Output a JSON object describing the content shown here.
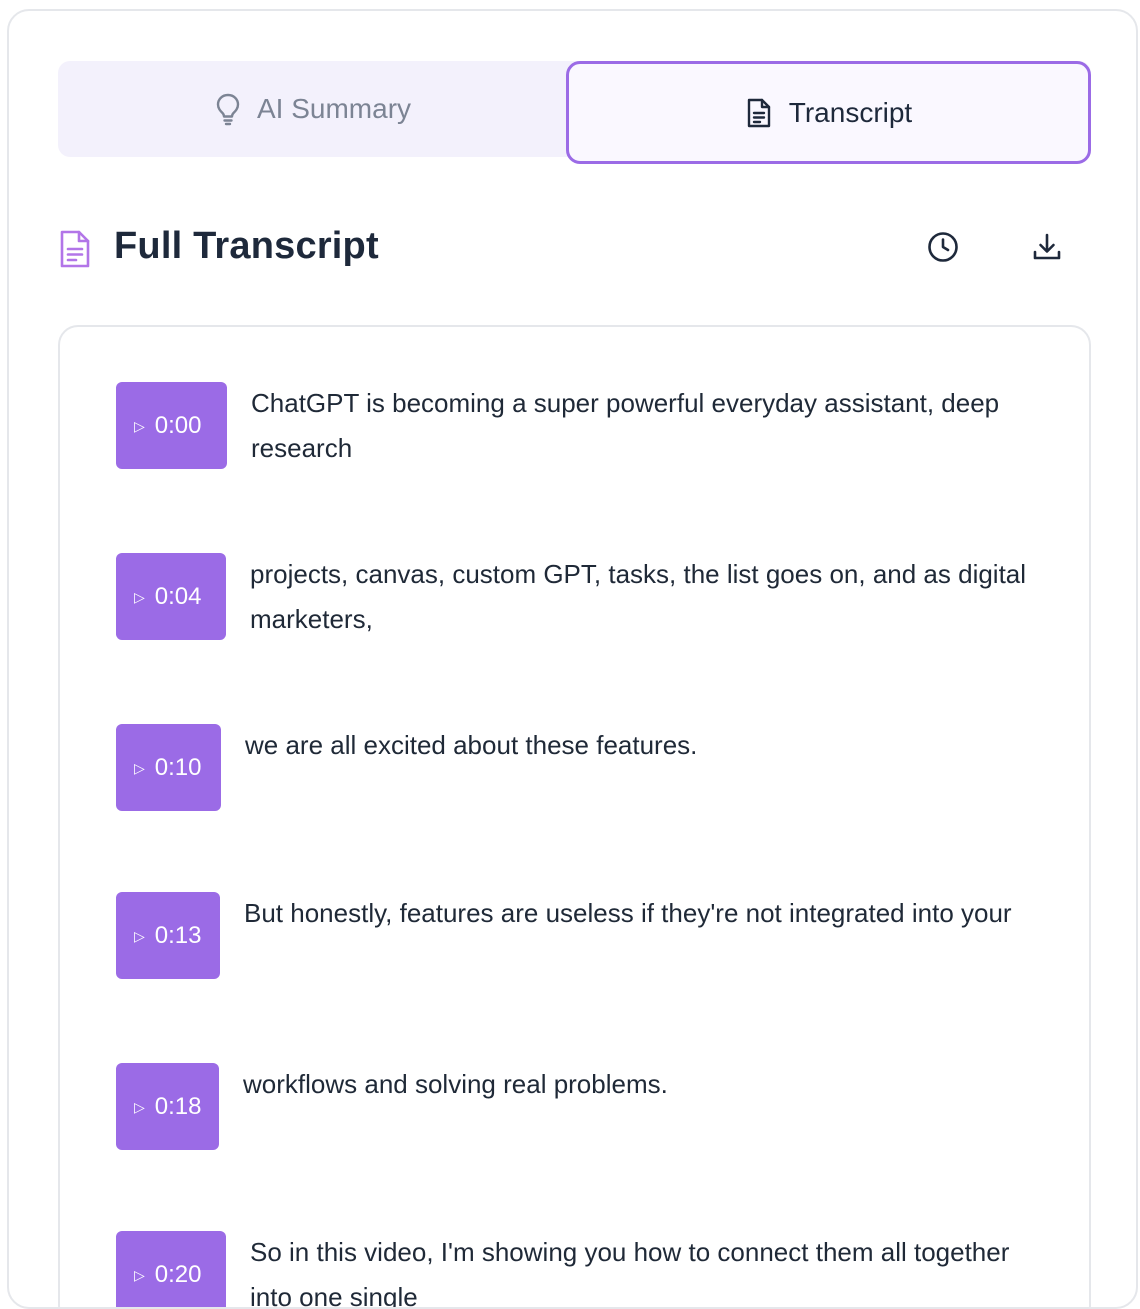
{
  "tabs": [
    {
      "label": "AI Summary",
      "icon": "lightbulb-icon",
      "active": false
    },
    {
      "label": "Transcript",
      "icon": "document-icon",
      "active": true
    }
  ],
  "header": {
    "title": "Full Transcript",
    "icon": "document-icon",
    "actions": [
      {
        "name": "history",
        "icon": "clock-icon"
      },
      {
        "name": "download",
        "icon": "download-icon"
      }
    ]
  },
  "colors": {
    "accent": "#9b6be6",
    "tab_bg": "#f3f1fc",
    "text": "#1e293b",
    "muted": "#7c8494"
  },
  "transcript": [
    {
      "time": "0:00",
      "text": "ChatGPT is becoming a super powerful everyday assistant, deep research"
    },
    {
      "time": "0:04",
      "text": "projects, canvas, custom GPT, tasks, the list goes on, and as digital marketers,"
    },
    {
      "time": "0:10",
      "text": "we are all excited about these features."
    },
    {
      "time": "0:13",
      "text": "But honestly, features are useless if they're not integrated into your"
    },
    {
      "time": "0:18",
      "text": "workflows and solving real problems."
    },
    {
      "time": "0:20",
      "text": "So in this video, I'm showing you how to connect them all together into one single"
    }
  ]
}
